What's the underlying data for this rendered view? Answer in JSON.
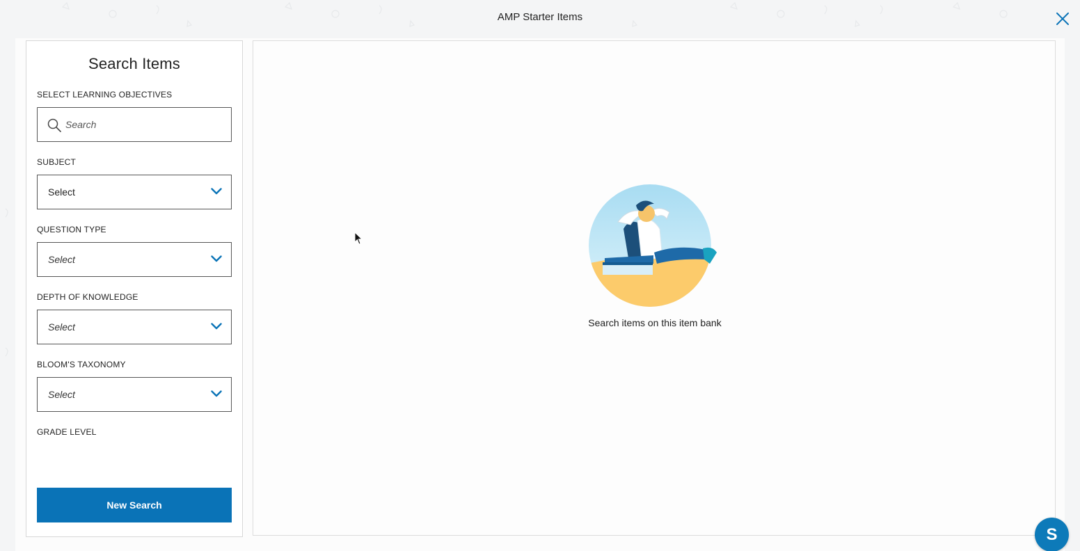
{
  "window": {
    "title": "AMP Starter Items",
    "close_icon": "close-icon"
  },
  "sidebar": {
    "title": "Search Items",
    "learning_objectives": {
      "label": "SELECT LEARNING OBJECTIVES",
      "placeholder": "Search",
      "value": ""
    },
    "subject": {
      "label": "SUBJECT",
      "value": "Select"
    },
    "question_type": {
      "label": "QUESTION TYPE",
      "value": "Select"
    },
    "depth_of_knowledge": {
      "label": "DEPTH OF KNOWLEDGE",
      "value": "Select"
    },
    "blooms_taxonomy": {
      "label": "BLOOM'S TAXONOMY",
      "value": "Select"
    },
    "grade_level": {
      "label": "GRADE LEVEL"
    },
    "new_search_label": "New Search"
  },
  "main": {
    "empty_state_text": "Search items on this item bank",
    "illustration": "relaxing-person-illustration"
  },
  "chat": {
    "label": "S",
    "icon": "chat-launcher-icon"
  },
  "colors": {
    "accent": "#0a73b7",
    "chevron": "#0a73b7",
    "chat": "#0d7ab9"
  }
}
